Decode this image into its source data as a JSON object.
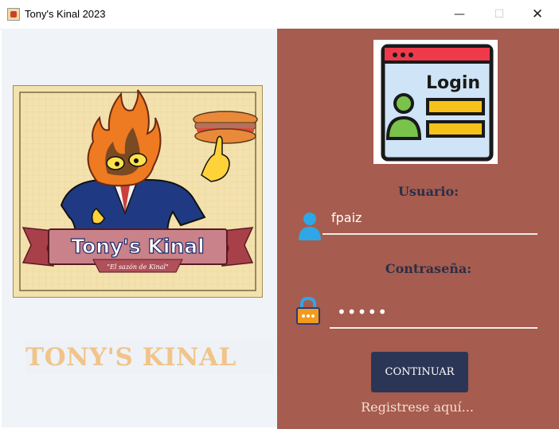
{
  "window": {
    "title": "Tony's Kinal 2023",
    "minimize_glyph": "—",
    "maximize_glyph": "☐",
    "close_glyph": "✕"
  },
  "left": {
    "logo": {
      "brand": "Tony's Kinal",
      "tagline": "\"El sazón de Kinal\""
    },
    "brand_text": "TONY'S KINAL"
  },
  "login": {
    "image_text": "Login",
    "username_label": "Usuario:",
    "username_value": "fpaiz",
    "password_label": "Contraseña:",
    "password_value": "•••••",
    "continue_label": "CONTINUAR",
    "register_link": "Registrese aquí..."
  },
  "colors": {
    "right_panel": "#a65c4e",
    "button": "#2b3657",
    "labels": "#2a2f48",
    "brand_text": "#f0c48a"
  },
  "icons": [
    "user-icon",
    "lock-icon",
    "login-window-icon",
    "tonys-kinal-logo"
  ]
}
